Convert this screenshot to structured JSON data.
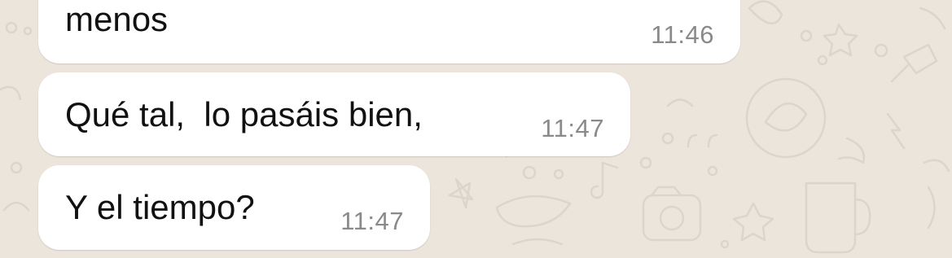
{
  "chat": {
    "background_color": "#ece5dc",
    "bubble_color": "#ffffff",
    "messages": [
      {
        "text": "menos",
        "time": "11:46"
      },
      {
        "text": "Qué tal,  lo pasáis bien,",
        "time": "11:47"
      },
      {
        "text": "Y el tiempo?",
        "time": "11:47"
      }
    ]
  }
}
